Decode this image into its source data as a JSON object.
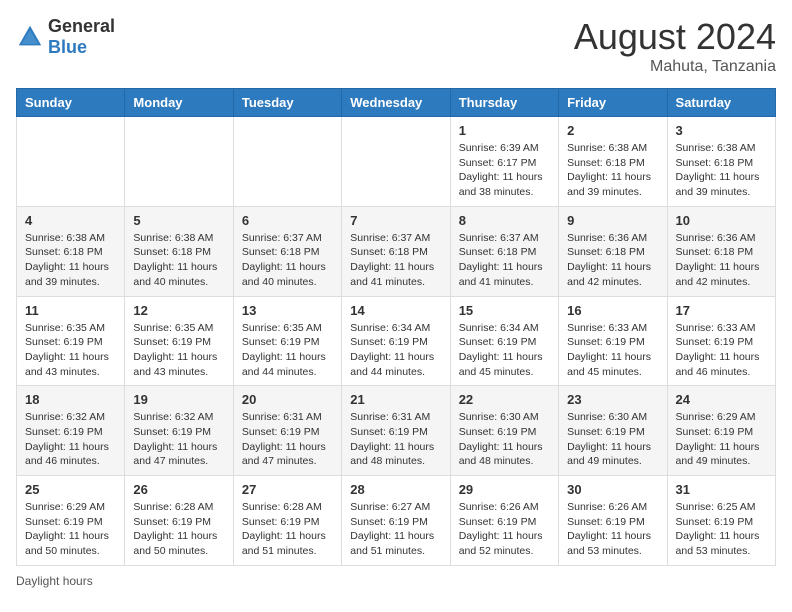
{
  "header": {
    "logo_general": "General",
    "logo_blue": "Blue",
    "month_year": "August 2024",
    "location": "Mahuta, Tanzania"
  },
  "days_of_week": [
    "Sunday",
    "Monday",
    "Tuesday",
    "Wednesday",
    "Thursday",
    "Friday",
    "Saturday"
  ],
  "weeks": [
    [
      {
        "day": "",
        "info": ""
      },
      {
        "day": "",
        "info": ""
      },
      {
        "day": "",
        "info": ""
      },
      {
        "day": "",
        "info": ""
      },
      {
        "day": "1",
        "info": "Sunrise: 6:39 AM\nSunset: 6:17 PM\nDaylight: 11 hours\nand 38 minutes."
      },
      {
        "day": "2",
        "info": "Sunrise: 6:38 AM\nSunset: 6:18 PM\nDaylight: 11 hours\nand 39 minutes."
      },
      {
        "day": "3",
        "info": "Sunrise: 6:38 AM\nSunset: 6:18 PM\nDaylight: 11 hours\nand 39 minutes."
      }
    ],
    [
      {
        "day": "4",
        "info": "Sunrise: 6:38 AM\nSunset: 6:18 PM\nDaylight: 11 hours\nand 39 minutes."
      },
      {
        "day": "5",
        "info": "Sunrise: 6:38 AM\nSunset: 6:18 PM\nDaylight: 11 hours\nand 40 minutes."
      },
      {
        "day": "6",
        "info": "Sunrise: 6:37 AM\nSunset: 6:18 PM\nDaylight: 11 hours\nand 40 minutes."
      },
      {
        "day": "7",
        "info": "Sunrise: 6:37 AM\nSunset: 6:18 PM\nDaylight: 11 hours\nand 41 minutes."
      },
      {
        "day": "8",
        "info": "Sunrise: 6:37 AM\nSunset: 6:18 PM\nDaylight: 11 hours\nand 41 minutes."
      },
      {
        "day": "9",
        "info": "Sunrise: 6:36 AM\nSunset: 6:18 PM\nDaylight: 11 hours\nand 42 minutes."
      },
      {
        "day": "10",
        "info": "Sunrise: 6:36 AM\nSunset: 6:18 PM\nDaylight: 11 hours\nand 42 minutes."
      }
    ],
    [
      {
        "day": "11",
        "info": "Sunrise: 6:35 AM\nSunset: 6:19 PM\nDaylight: 11 hours\nand 43 minutes."
      },
      {
        "day": "12",
        "info": "Sunrise: 6:35 AM\nSunset: 6:19 PM\nDaylight: 11 hours\nand 43 minutes."
      },
      {
        "day": "13",
        "info": "Sunrise: 6:35 AM\nSunset: 6:19 PM\nDaylight: 11 hours\nand 44 minutes."
      },
      {
        "day": "14",
        "info": "Sunrise: 6:34 AM\nSunset: 6:19 PM\nDaylight: 11 hours\nand 44 minutes."
      },
      {
        "day": "15",
        "info": "Sunrise: 6:34 AM\nSunset: 6:19 PM\nDaylight: 11 hours\nand 45 minutes."
      },
      {
        "day": "16",
        "info": "Sunrise: 6:33 AM\nSunset: 6:19 PM\nDaylight: 11 hours\nand 45 minutes."
      },
      {
        "day": "17",
        "info": "Sunrise: 6:33 AM\nSunset: 6:19 PM\nDaylight: 11 hours\nand 46 minutes."
      }
    ],
    [
      {
        "day": "18",
        "info": "Sunrise: 6:32 AM\nSunset: 6:19 PM\nDaylight: 11 hours\nand 46 minutes."
      },
      {
        "day": "19",
        "info": "Sunrise: 6:32 AM\nSunset: 6:19 PM\nDaylight: 11 hours\nand 47 minutes."
      },
      {
        "day": "20",
        "info": "Sunrise: 6:31 AM\nSunset: 6:19 PM\nDaylight: 11 hours\nand 47 minutes."
      },
      {
        "day": "21",
        "info": "Sunrise: 6:31 AM\nSunset: 6:19 PM\nDaylight: 11 hours\nand 48 minutes."
      },
      {
        "day": "22",
        "info": "Sunrise: 6:30 AM\nSunset: 6:19 PM\nDaylight: 11 hours\nand 48 minutes."
      },
      {
        "day": "23",
        "info": "Sunrise: 6:30 AM\nSunset: 6:19 PM\nDaylight: 11 hours\nand 49 minutes."
      },
      {
        "day": "24",
        "info": "Sunrise: 6:29 AM\nSunset: 6:19 PM\nDaylight: 11 hours\nand 49 minutes."
      }
    ],
    [
      {
        "day": "25",
        "info": "Sunrise: 6:29 AM\nSunset: 6:19 PM\nDaylight: 11 hours\nand 50 minutes."
      },
      {
        "day": "26",
        "info": "Sunrise: 6:28 AM\nSunset: 6:19 PM\nDaylight: 11 hours\nand 50 minutes."
      },
      {
        "day": "27",
        "info": "Sunrise: 6:28 AM\nSunset: 6:19 PM\nDaylight: 11 hours\nand 51 minutes."
      },
      {
        "day": "28",
        "info": "Sunrise: 6:27 AM\nSunset: 6:19 PM\nDaylight: 11 hours\nand 51 minutes."
      },
      {
        "day": "29",
        "info": "Sunrise: 6:26 AM\nSunset: 6:19 PM\nDaylight: 11 hours\nand 52 minutes."
      },
      {
        "day": "30",
        "info": "Sunrise: 6:26 AM\nSunset: 6:19 PM\nDaylight: 11 hours\nand 53 minutes."
      },
      {
        "day": "31",
        "info": "Sunrise: 6:25 AM\nSunset: 6:19 PM\nDaylight: 11 hours\nand 53 minutes."
      }
    ]
  ],
  "footer": {
    "note": "Daylight hours"
  }
}
